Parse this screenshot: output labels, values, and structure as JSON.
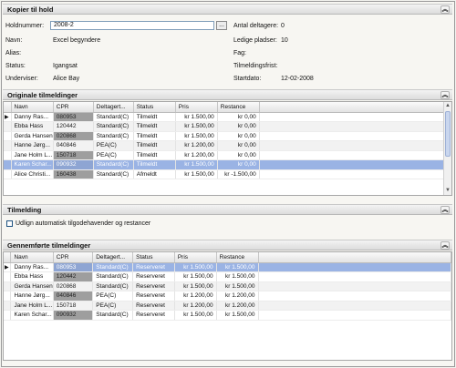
{
  "kopier": {
    "title": "Kopier til hold",
    "holdnummer_label": "Holdnummer:",
    "holdnummer_value": "2008-2",
    "browse_label": "...",
    "navn_label": "Navn:",
    "navn_value": "Excel begyndere",
    "alias_label": "Alias:",
    "status_label": "Status:",
    "status_value": "Igangsat",
    "underviser_label": "Underviser:",
    "underviser_value": "Alice Bay",
    "antal_label": "Antal deltagere:",
    "antal_value": "0",
    "ledige_label": "Ledige pladser:",
    "ledige_value": "10",
    "fag_label": "Fag:",
    "tilmeldingsfrist_label": "Tilmeldingsfrist:",
    "startdato_label": "Startdato:",
    "startdato_value": "12-02-2008"
  },
  "originale": {
    "title": "Originale tilmeldinger",
    "columns": [
      "Navn",
      "CPR",
      "Deltagert...",
      "Status",
      "Pris",
      "Restance"
    ],
    "rows": [
      {
        "navn": "Danny Ras...",
        "cpr": "080953",
        "deltager": "Standard(C)",
        "status": "Tilmeldt",
        "pris": "kr 1.500,00",
        "restance": "kr 0,00"
      },
      {
        "navn": "Ebba Hass",
        "cpr": "120442",
        "deltager": "Standard(C)",
        "status": "Tilmeldt",
        "pris": "kr 1.500,00",
        "restance": "kr 0,00"
      },
      {
        "navn": "Gerda Hansen",
        "cpr": "020868",
        "deltager": "Standard(C)",
        "status": "Tilmeldt",
        "pris": "kr 1.500,00",
        "restance": "kr 0,00"
      },
      {
        "navn": "Hanne Jørg...",
        "cpr": "040846",
        "deltager": "PEA(C)",
        "status": "Tilmeldt",
        "pris": "kr 1.200,00",
        "restance": "kr 0,00"
      },
      {
        "navn": "Jane Holm L...",
        "cpr": "150718",
        "deltager": "PEA(C)",
        "status": "Tilmeldt",
        "pris": "kr 1.200,00",
        "restance": "kr 0,00"
      },
      {
        "navn": "Karen Schar...",
        "cpr": "090932",
        "deltager": "Standard(C)",
        "status": "Tilmeldt",
        "pris": "kr 1.500,00",
        "restance": "kr 0,00"
      },
      {
        "navn": "Alice Christi...",
        "cpr": "160438",
        "deltager": "Standard(C)",
        "status": "Afmeldt",
        "pris": "kr 1.500,00",
        "restance": "kr -1.500,00"
      }
    ]
  },
  "tilmelding": {
    "title": "Tilmelding",
    "checkbox_label": "Udlign automatisk tilgodehavender og restancer"
  },
  "gennemforte": {
    "title": "Gennemførte tilmeldinger",
    "columns": [
      "Navn",
      "CPR",
      "Deltagert...",
      "Status",
      "Pris",
      "Restance"
    ],
    "rows": [
      {
        "navn": "Danny Ras...",
        "cpr": "080953",
        "deltager": "Standard(C)",
        "status": "Reserveret",
        "pris": "kr 1.500,00",
        "restance": "kr 1.500,00"
      },
      {
        "navn": "Ebba Hass",
        "cpr": "120442",
        "deltager": "Standard(C)",
        "status": "Reserveret",
        "pris": "kr 1.500,00",
        "restance": "kr 1.500,00"
      },
      {
        "navn": "Gerda Hansen",
        "cpr": "020868",
        "deltager": "Standard(C)",
        "status": "Reserveret",
        "pris": "kr 1.500,00",
        "restance": "kr 1.500,00"
      },
      {
        "navn": "Hanne Jørg...",
        "cpr": "040846",
        "deltager": "PEA(C)",
        "status": "Reserveret",
        "pris": "kr 1.200,00",
        "restance": "kr 1.200,00"
      },
      {
        "navn": "Jane Holm L...",
        "cpr": "150718",
        "deltager": "PEA(C)",
        "status": "Reserveret",
        "pris": "kr 1.200,00",
        "restance": "kr 1.200,00"
      },
      {
        "navn": "Karen Schar...",
        "cpr": "090932",
        "deltager": "Standard(C)",
        "status": "Reserveret",
        "pris": "kr 1.500,00",
        "restance": "kr 1.500,00"
      }
    ]
  },
  "icons": {
    "collapse": "double-chevron-up-icon",
    "row_pointer": "row-pointer-icon"
  },
  "colors": {
    "selection": "#9ab3e4",
    "masked_cpr": "#9e9e9e"
  }
}
